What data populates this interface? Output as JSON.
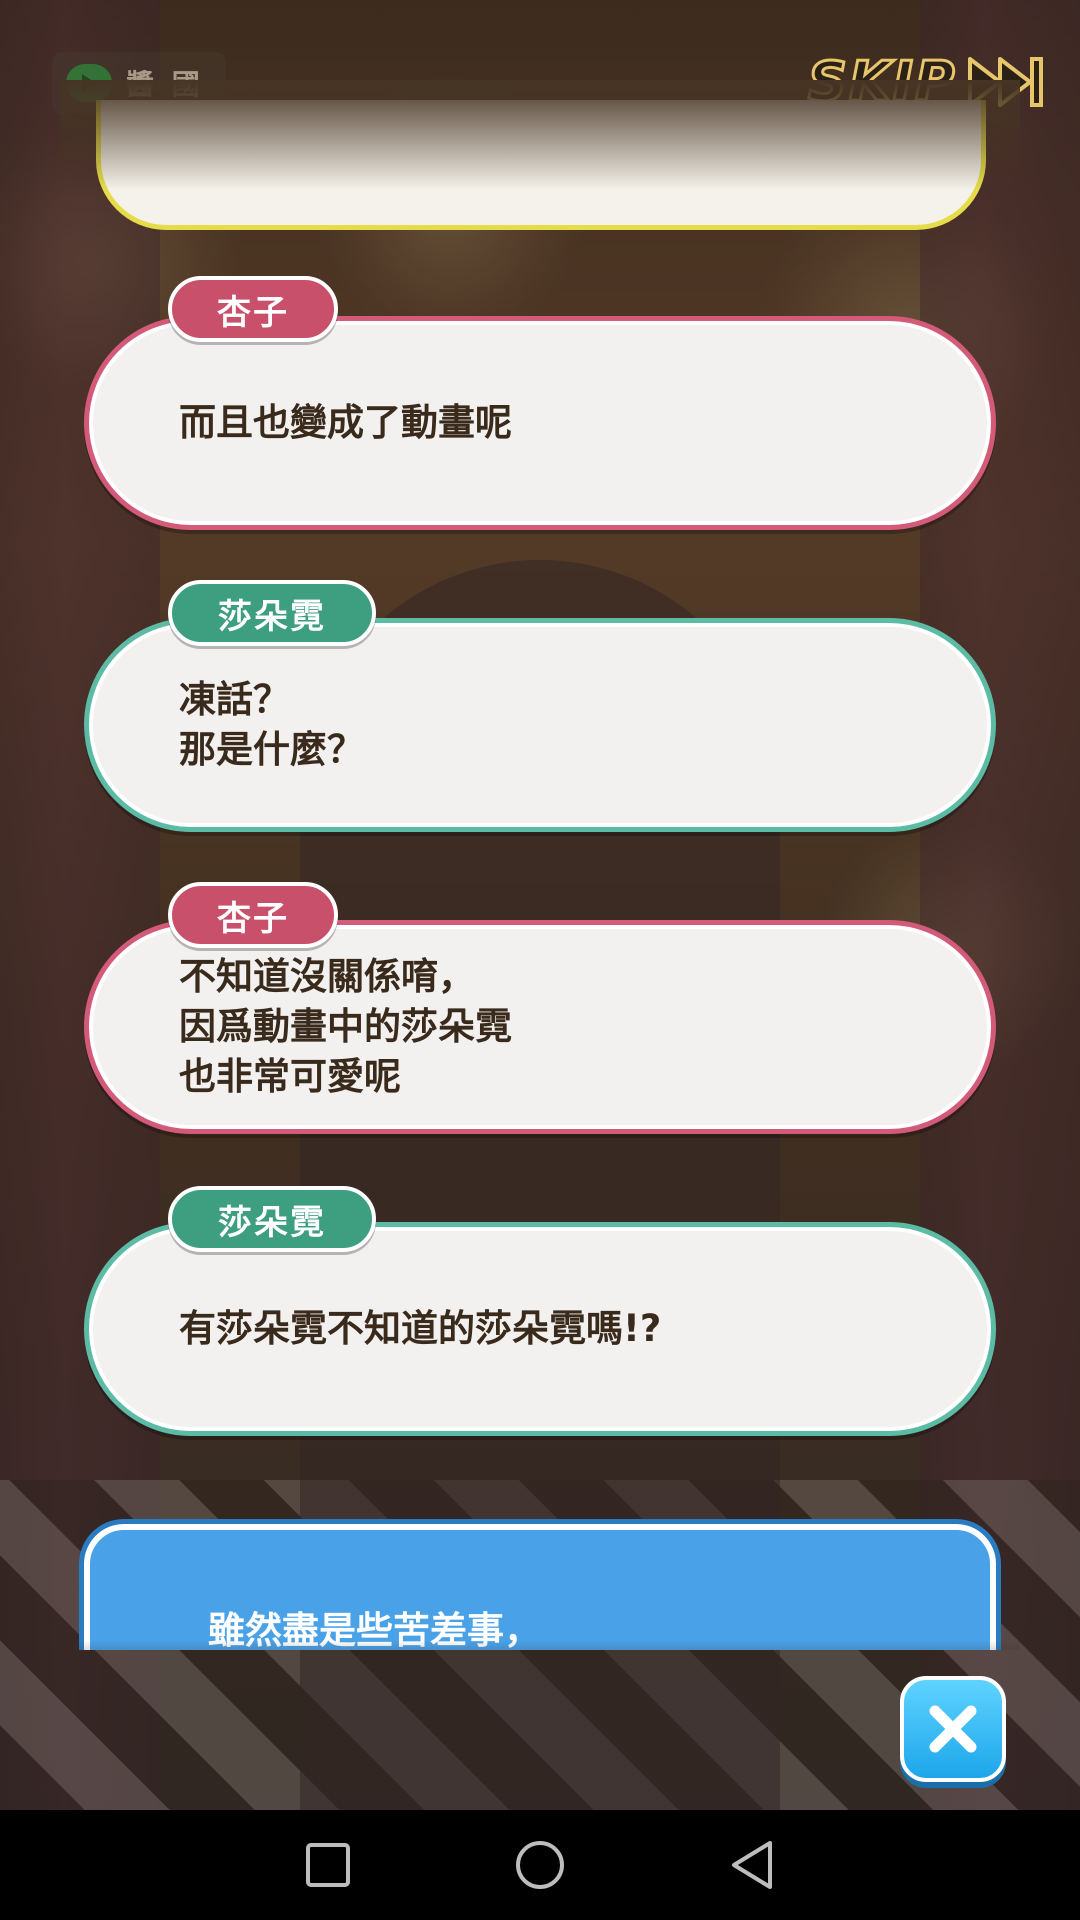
{
  "top_bar": {
    "log_label": "醬 國",
    "skip_label": "SKIP"
  },
  "dialog_log": [
    {
      "speaker": "杏子",
      "color": "pink",
      "lines": [
        "而且也變成了動畫呢"
      ]
    },
    {
      "speaker": "莎朵霓",
      "color": "green",
      "lines": [
        "凍話？",
        "那是什麼？"
      ]
    },
    {
      "speaker": "杏子",
      "color": "pink",
      "lines": [
        "不知道沒關係唷，",
        "因爲動畫中的莎朵霓",
        "也非常可愛呢"
      ]
    },
    {
      "speaker": "莎朵霓",
      "color": "green",
      "lines": [
        "有莎朵霓不知道的莎朵霓嗎!?"
      ]
    }
  ],
  "narration": {
    "text": "雖然盡是些苦差事，"
  },
  "icons": {
    "close": "close-icon",
    "skip": "fast-forward-icon",
    "log": "chat-bubble-icon",
    "nav": [
      "square-icon",
      "circle-icon",
      "back-triangle-icon"
    ]
  },
  "colors": {
    "pink_accent": "#c8506a",
    "green_accent": "#3d9e80",
    "narration_blue": "#49a2e8",
    "close_blue": "#1da6ea"
  }
}
